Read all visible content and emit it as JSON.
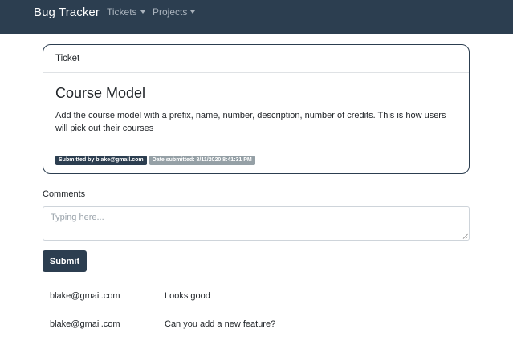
{
  "navbar": {
    "brand": "Bug Tracker",
    "menus": [
      {
        "label": "Tickets"
      },
      {
        "label": "Projects"
      }
    ]
  },
  "ticket": {
    "header": "Ticket",
    "title": "Course Model",
    "description": "Add the course model with a prefix, name, number, description, number of credits. This is how users will pick out their courses",
    "submitted_by": "Submitted by blake@gmail.com",
    "date_submitted": "Date submitted: 8/11/2020 8:41:31 PM"
  },
  "comments": {
    "label": "Comments",
    "placeholder": "Typing here...",
    "submit_label": "Submit",
    "rows": [
      {
        "author": "blake@gmail.com",
        "text": "Looks good"
      },
      {
        "author": "blake@gmail.com",
        "text": "Can you add a new feature?"
      }
    ]
  },
  "colors": {
    "primary": "#2c3e50",
    "badge_secondary": "#95a0a6",
    "nav_link": "#aab3bd"
  }
}
